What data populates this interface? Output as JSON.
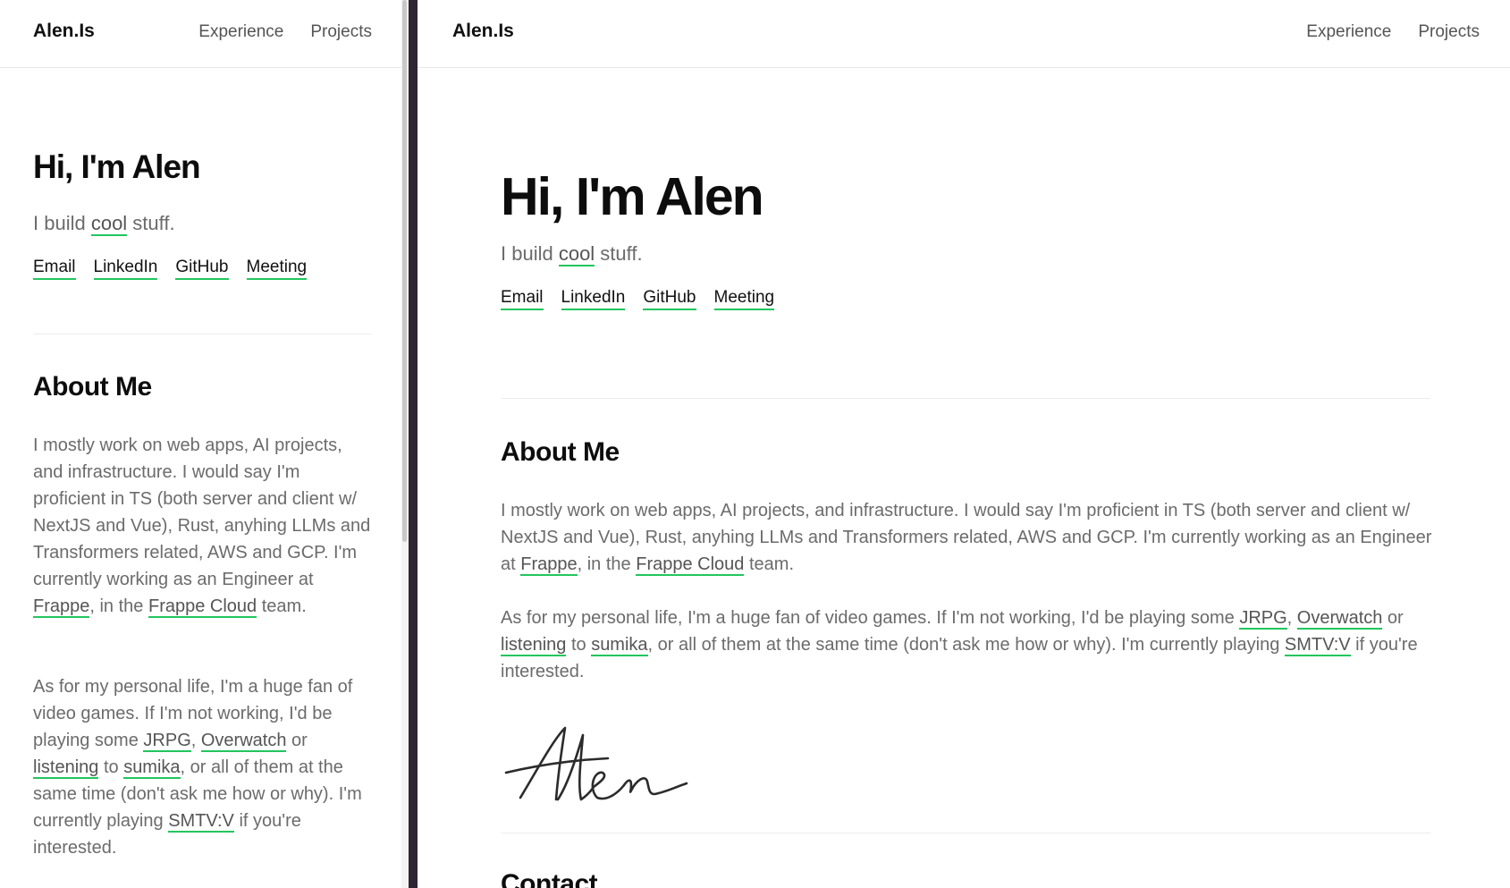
{
  "nav": {
    "brand": "Alen.Is",
    "links": [
      "Experience",
      "Projects"
    ]
  },
  "hero": {
    "title": "Hi, I'm Alen",
    "subtitle_pre": "I build ",
    "subtitle_link": "cool",
    "subtitle_post": " stuff.",
    "social_links": [
      "Email",
      "LinkedIn",
      "GitHub",
      "Meeting"
    ]
  },
  "about": {
    "heading": "About Me",
    "para1": {
      "text1": "I mostly work on web apps, AI projects, and infrastructure. I would say I'm proficient in TS (both server and client w/ NextJS and Vue), Rust, anyhing LLMs and Transformers related, AWS and GCP. I'm currently working as an Engineer at ",
      "link1": "Frappe",
      "text2": ", in the ",
      "link2": "Frappe Cloud",
      "text3": " team."
    },
    "para2": {
      "text1": "As for my personal life, I'm a huge fan of video games. If I'm not working, I'd be playing some ",
      "link1": "JRPG",
      "text2": ", ",
      "link2": "Overwatch",
      "text3": " or ",
      "link3": "listening",
      "text4": " to ",
      "link4": "sumika",
      "text5": ", or all of them at the same time (don't ask me how or why). I'm currently playing ",
      "link5": "SMTV:V",
      "text6": " if you're interested."
    },
    "signature": "Alen"
  },
  "contact": {
    "heading": "Contact"
  },
  "colors": {
    "accent": "#22c55e",
    "text": "#111111",
    "muted": "#6b6b6b",
    "divider": "#2d2532"
  }
}
